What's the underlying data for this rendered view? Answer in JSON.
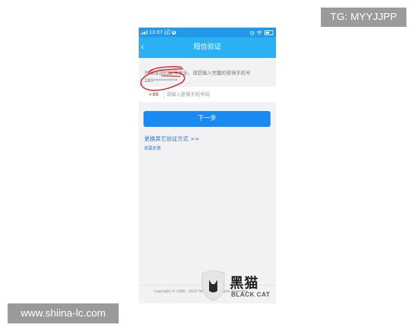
{
  "overlay": {
    "tg_label": "TG: MYYJJPP",
    "site_label": "www.shiina-lc.com"
  },
  "status_bar": {
    "time": "13:07",
    "speed": "1.20",
    "unit": "KB/s",
    "notification": "B"
  },
  "nav": {
    "title": "短信验证",
    "back_glyph": "‹"
  },
  "content": {
    "hint": "为保障您的账号安全，请您输入完整的密保手机号",
    "masked_phone": "180**********",
    "country_code": "+86",
    "phone_placeholder": "请输入密保手机号码",
    "next_button": "下一步",
    "alt_verify_link": "更换其它验证方式 >>",
    "feedback_link": "我要反馈"
  },
  "footer": {
    "copyright": "Copyright © 1998 - 2020 Tencent. All Rights Reserved."
  },
  "watermark": {
    "chinese": "黑猫",
    "english": "BLACK CAT"
  },
  "colors": {
    "status_bar": "#229ae9",
    "nav_bar": "#2ab0f3",
    "button": "#1a8af3",
    "link": "#2a78c8",
    "annotation": "#d8262c"
  }
}
